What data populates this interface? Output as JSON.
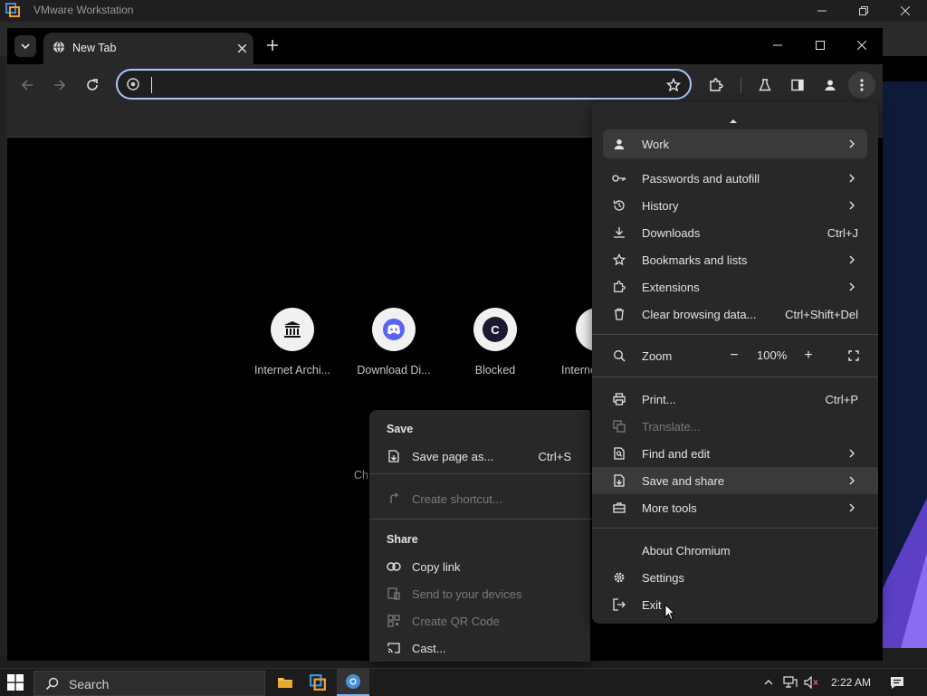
{
  "vmware": {
    "title": "VMware Workstation"
  },
  "browser": {
    "tab_title": "New Tab",
    "omnibox_value": ""
  },
  "ntp": {
    "tiles": [
      {
        "label": "Internet Archi...",
        "icon": "archive-icon"
      },
      {
        "label": "Download Di...",
        "icon": "discord-icon"
      },
      {
        "label": "Blocked",
        "icon": "letter-c-icon",
        "letter": "C"
      },
      {
        "label": "Interne",
        "icon": "archive-icon"
      }
    ],
    "hint_fragment": "Ch"
  },
  "menu": {
    "profile": "Work",
    "passwords": "Passwords and autofill",
    "history": "History",
    "downloads": "Downloads",
    "downloads_shortcut": "Ctrl+J",
    "bookmarks": "Bookmarks and lists",
    "extensions": "Extensions",
    "clear": "Clear browsing data...",
    "clear_shortcut": "Ctrl+Shift+Del",
    "zoom": "Zoom",
    "zoom_minus": "−",
    "zoom_value": "100%",
    "zoom_plus": "+",
    "print": "Print...",
    "print_shortcut": "Ctrl+P",
    "translate": "Translate...",
    "find": "Find and edit",
    "save_share": "Save and share",
    "more_tools": "More tools",
    "about": "About Chromium",
    "settings": "Settings",
    "exit": "Exit"
  },
  "submenu": {
    "save_header": "Save",
    "save_page": "Save page as...",
    "save_page_shortcut": "Ctrl+S",
    "create_shortcut": "Create shortcut...",
    "share_header": "Share",
    "copy_link": "Copy link",
    "send_devices": "Send to your devices",
    "qr_code": "Create QR Code",
    "cast": "Cast..."
  },
  "taskbar": {
    "search_label": "Search",
    "time": "2:22 AM"
  },
  "colors": {
    "accent": "#a8c7fa",
    "menu_bg": "#282828",
    "ntp_bg": "#000000"
  }
}
